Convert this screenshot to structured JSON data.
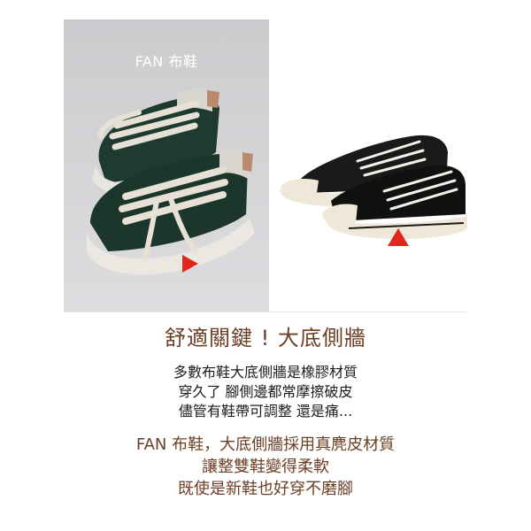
{
  "left_photo": {
    "caption": "FAN 布鞋",
    "pointer_color": "#e1261c"
  },
  "right_photo": {
    "pointer_color": "#e1261c"
  },
  "headline": "舒適關鍵 ! 大底側牆",
  "body_lines": [
    "多數布鞋大底側牆是橡膠材質",
    "穿久了 腳側邊都常摩擦破皮",
    "儘管有鞋帶可調整 還是痛..."
  ],
  "highlight_lines": [
    "FAN 布鞋，大底側牆採用真麂皮材質",
    "讓整雙鞋變得柔軟",
    "既使是新鞋也好穿不磨腳"
  ],
  "colors": {
    "accent_brown": "#6b3f24",
    "pointer_red": "#e1261c"
  }
}
